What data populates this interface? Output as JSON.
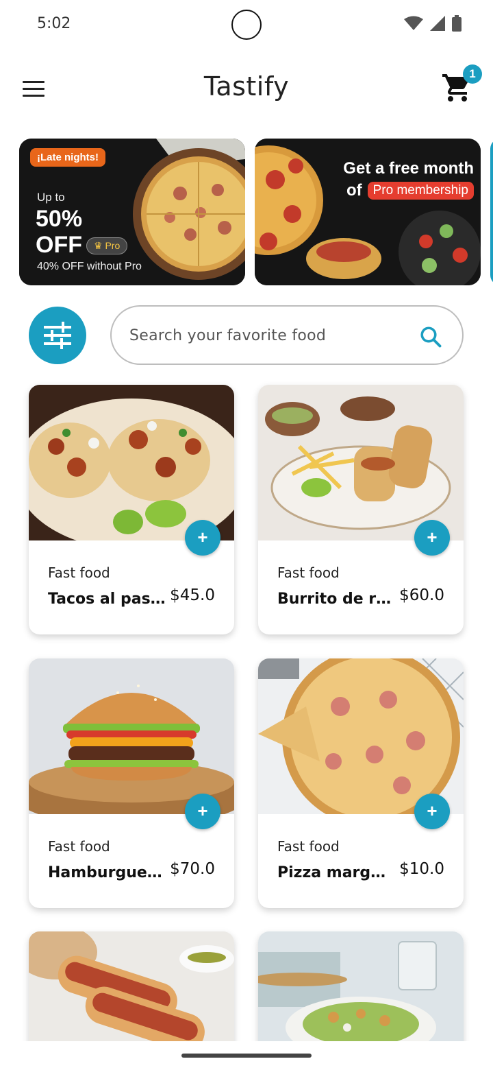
{
  "status": {
    "time": "5:02"
  },
  "appbar": {
    "title": "Tastify",
    "cart_count": "1"
  },
  "banners": {
    "b1": {
      "tag": "¡Late nights!",
      "upto": "Up to",
      "big1": "50%",
      "big2": "OFF",
      "pro": "Pro",
      "sub": "40% OFF without Pro"
    },
    "b2": {
      "line1": "Get a free month",
      "of": "of",
      "pro": "Pro membership"
    }
  },
  "search": {
    "placeholder": "Search your favorite food"
  },
  "products": [
    {
      "category": "Fast food",
      "name": "Tacos al past…",
      "price": "$45.0"
    },
    {
      "category": "Fast food",
      "name": "Burrito de res",
      "price": "$60.0"
    },
    {
      "category": "Fast food",
      "name": "Hamburgues…",
      "price": "$70.0"
    },
    {
      "category": "Fast food",
      "name": "Pizza margar…",
      "price": "$10.0"
    }
  ],
  "add_label": "+",
  "colors": {
    "accent": "#1b9ec1",
    "banner_dark": "#141414",
    "late_tag": "#e8661a",
    "pro_tag": "#e53d2f"
  },
  "icons": [
    "menu-icon",
    "cart-icon",
    "filter-sliders-icon",
    "search-icon",
    "wifi-icon",
    "signal-icon",
    "battery-icon"
  ]
}
